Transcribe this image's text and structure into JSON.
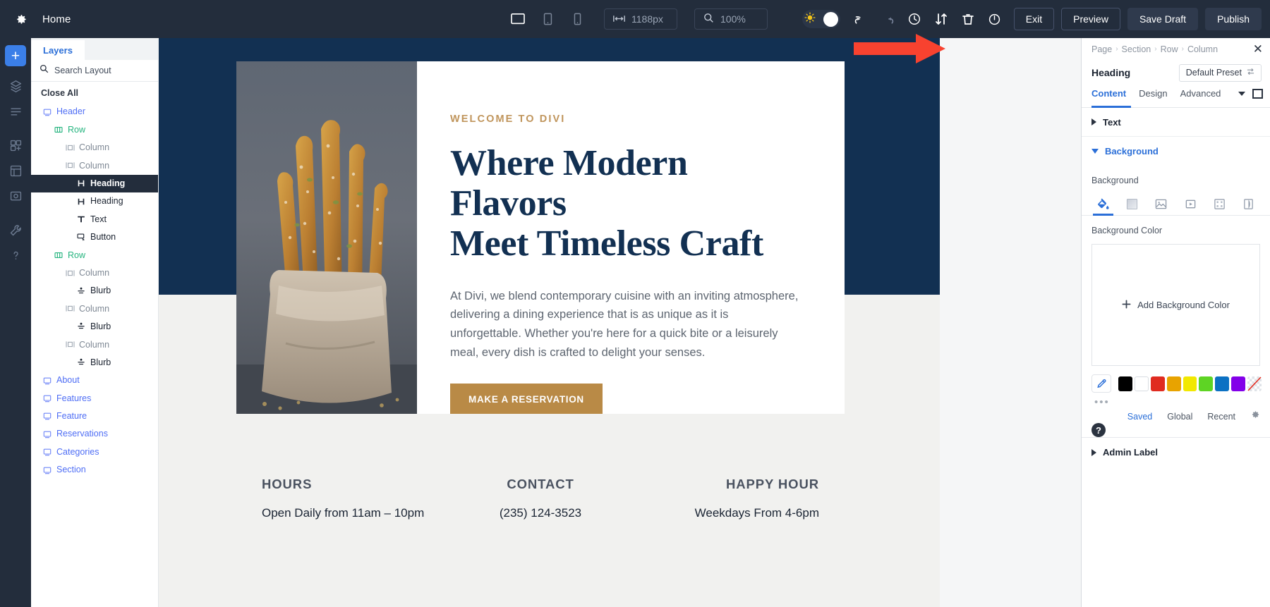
{
  "toolbar": {
    "gear_icon": "gear-icon",
    "title": "Home",
    "devices": [
      {
        "name": "desktop-view",
        "icon": "desktop-icon",
        "active": true
      },
      {
        "name": "tablet-view",
        "icon": "tablet-icon",
        "active": false
      },
      {
        "name": "phone-view",
        "icon": "phone-icon",
        "active": false
      }
    ],
    "width_icon": "width-arrows-icon",
    "width_value": "1188px",
    "zoom_icon": "magnifier-icon",
    "zoom_value": "100%",
    "theme_toggle": {
      "name": "light-dark-toggle",
      "icon": "sun-icon"
    },
    "icons": [
      {
        "name": "undo-icon"
      },
      {
        "name": "redo-icon"
      },
      {
        "name": "history-clock-icon"
      },
      {
        "name": "sort-arrows-icon"
      },
      {
        "name": "trash-icon"
      },
      {
        "name": "power-icon"
      }
    ],
    "exit_label": "Exit",
    "preview_label": "Preview",
    "save_draft_label": "Save Draft",
    "publish_label": "Publish"
  },
  "rail": {
    "add_label": "+",
    "items": [
      {
        "name": "rail-layers-icon"
      },
      {
        "name": "rail-wireframe-icon"
      },
      {
        "name": "rail-portability-icon"
      },
      {
        "name": "rail-library-icon"
      },
      {
        "name": "rail-history-icon"
      },
      {
        "name": "rail-tools-icon"
      },
      {
        "name": "rail-help-icon"
      }
    ]
  },
  "layers": {
    "tab_label": "Layers",
    "search_placeholder": "Search Layout",
    "search_value": "",
    "filter_icon": "filter-icon",
    "close_all_label": "Close All",
    "items": [
      {
        "label": "Header",
        "type": "section",
        "indent": 0,
        "icon": "section-icon",
        "selected": false
      },
      {
        "label": "Row",
        "type": "row",
        "indent": 1,
        "icon": "row-icon",
        "selected": false
      },
      {
        "label": "Column",
        "type": "column",
        "indent": 2,
        "icon": "column-icon",
        "selected": false
      },
      {
        "label": "Column",
        "type": "column",
        "indent": 2,
        "icon": "column-icon",
        "selected": false
      },
      {
        "label": "Heading",
        "type": "module",
        "indent": 3,
        "icon": "heading-icon",
        "selected": true
      },
      {
        "label": "Heading",
        "type": "module",
        "indent": 3,
        "icon": "heading-icon",
        "selected": false
      },
      {
        "label": "Text",
        "type": "module",
        "indent": 3,
        "icon": "text-icon",
        "selected": false
      },
      {
        "label": "Button",
        "type": "module",
        "indent": 3,
        "icon": "button-icon",
        "selected": false
      },
      {
        "label": "Row",
        "type": "row",
        "indent": 1,
        "icon": "row-icon",
        "selected": false
      },
      {
        "label": "Column",
        "type": "column",
        "indent": 2,
        "icon": "column-icon",
        "selected": false
      },
      {
        "label": "Blurb",
        "type": "module",
        "indent": 3,
        "icon": "blurb-icon",
        "selected": false
      },
      {
        "label": "Column",
        "type": "column",
        "indent": 2,
        "icon": "column-icon",
        "selected": false
      },
      {
        "label": "Blurb",
        "type": "module",
        "indent": 3,
        "icon": "blurb-icon",
        "selected": false
      },
      {
        "label": "Column",
        "type": "column",
        "indent": 2,
        "icon": "column-icon",
        "selected": false
      },
      {
        "label": "Blurb",
        "type": "module",
        "indent": 3,
        "icon": "blurb-icon",
        "selected": false
      },
      {
        "label": "About",
        "type": "section",
        "indent": 0,
        "icon": "section-icon",
        "selected": false
      },
      {
        "label": "Features",
        "type": "section",
        "indent": 0,
        "icon": "section-icon",
        "selected": false
      },
      {
        "label": "Feature",
        "type": "section",
        "indent": 0,
        "icon": "section-icon",
        "selected": false
      },
      {
        "label": "Reservations",
        "type": "section",
        "indent": 0,
        "icon": "section-icon",
        "selected": false
      },
      {
        "label": "Categories",
        "type": "section",
        "indent": 0,
        "icon": "section-icon",
        "selected": false
      },
      {
        "label": "Section",
        "type": "section",
        "indent": 0,
        "icon": "section-icon",
        "selected": false
      }
    ]
  },
  "canvas": {
    "hero": {
      "eyebrow": "WELCOME TO DIVI",
      "heading_line1": "Where Modern Flavors",
      "heading_line2": "Meet Timeless Craft",
      "paragraph": "At Divi, we blend contemporary cuisine with an inviting atmosphere, delivering a dining experience that is as unique as it is unforgettable. Whether you're here for a quick bite or a leisurely meal, every dish is crafted to delight your senses.",
      "button_label": "MAKE A RESERVATION",
      "image_alt": "breadsticks-photo"
    },
    "info": [
      {
        "title": "HOURS",
        "value": "Open Daily from 11am – 10pm"
      },
      {
        "title": "CONTACT",
        "value": "(235) 124-3523"
      },
      {
        "title": "HAPPY HOUR",
        "value": "Weekdays From 4-6pm"
      }
    ],
    "colors": {
      "band": "#123052",
      "heading": "#123052",
      "eyebrow": "#c0955c",
      "button": "#b98a46"
    }
  },
  "settings": {
    "breadcrumb": [
      "Page",
      "Section",
      "Row",
      "Column"
    ],
    "close_icon": "close-icon",
    "module_title": "Heading",
    "preset_label": "Default Preset",
    "preset_icon": "preset-swap-icon",
    "tabs": [
      {
        "label": "Content",
        "active": true
      },
      {
        "label": "Design",
        "active": false
      },
      {
        "label": "Advanced",
        "active": false
      }
    ],
    "text_section_label": "Text",
    "background_section_label": "Background",
    "background_field_label": "Background",
    "bg_tabs": [
      {
        "name": "bg-color-tab",
        "icon": "paint-bucket-icon",
        "active": true
      },
      {
        "name": "bg-gradient-tab",
        "icon": "gradient-icon",
        "active": false
      },
      {
        "name": "bg-image-tab",
        "icon": "image-icon",
        "active": false
      },
      {
        "name": "bg-video-tab",
        "icon": "video-icon",
        "active": false
      },
      {
        "name": "bg-pattern-tab",
        "icon": "pattern-icon",
        "active": false
      },
      {
        "name": "bg-mask-tab",
        "icon": "mask-icon",
        "active": false
      }
    ],
    "background_color_label": "Background Color",
    "add_background_color_label": "Add Background Color",
    "add_icon": "plus-icon",
    "eyedropper_icon": "eyedropper-icon",
    "swatches": [
      "#000000",
      "#ffffff",
      "#e02b20",
      "#e8a300",
      "#f2e800",
      "#5ed424",
      "#0c71c3",
      "#8300e9",
      "transparent"
    ],
    "more_dots": "•••",
    "palette_links": [
      {
        "label": "Saved",
        "active": true
      },
      {
        "label": "Global",
        "active": false
      },
      {
        "label": "Recent",
        "active": false
      }
    ],
    "palette_gear_icon": "gear-icon",
    "admin_label_section": "Admin Label",
    "help_label": "?"
  },
  "annotation": {
    "arrow_color": "#f8422f",
    "arrow_name": "red-pointer-arrow"
  }
}
